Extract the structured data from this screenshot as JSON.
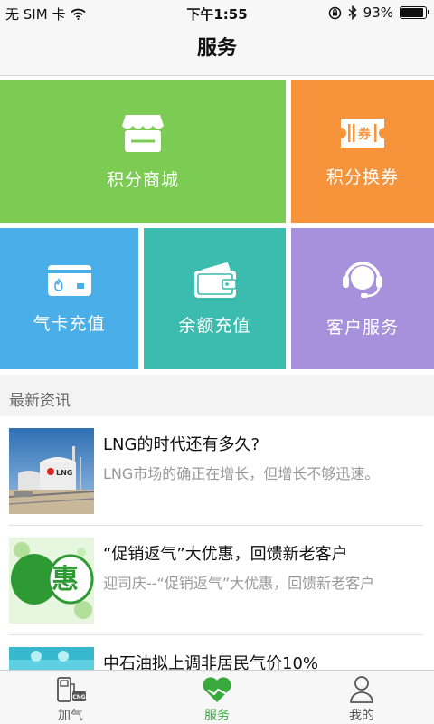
{
  "status_bar": {
    "carrier": "无 SIM 卡",
    "time": "下午1:55",
    "battery_percent": "93%",
    "battery_level": 0.93
  },
  "nav": {
    "title": "服务"
  },
  "tiles": {
    "mall": {
      "label": "积分商城",
      "icon": "store-icon",
      "color": "#7ccc54"
    },
    "coupon": {
      "label": "积分换券",
      "icon": "coupon-icon",
      "coupon_text": "券",
      "color": "#f7943b"
    },
    "gas_card": {
      "label": "气卡充值",
      "icon": "gas-card-icon",
      "color": "#4aaee8"
    },
    "balance": {
      "label": "余额充值",
      "icon": "wallet-icon",
      "color": "#3cbcae"
    },
    "customer_service": {
      "label": "客户服务",
      "icon": "headset-icon",
      "color": "#a891dc"
    }
  },
  "news": {
    "header": "最新资讯",
    "items": [
      {
        "title": "LNG的时代还有多久?",
        "desc": "LNG市场的确正在增长，但增长不够迅速。",
        "thumb": "lng-tank-photo",
        "thumb_text": "LNG"
      },
      {
        "title": "“促销返气”大优惠，回馈新老客户",
        "desc": "迎司庆--“促销返气”大优惠，回馈新老客户",
        "thumb": "promotion-image",
        "thumb_text": "优惠"
      },
      {
        "title": "中石油拟上调非居民气价10%",
        "desc": "",
        "thumb": "news-image"
      }
    ]
  },
  "tab_bar": {
    "items": [
      {
        "label": "加气",
        "icon": "gas-pump-icon",
        "badge_text": "CNG"
      },
      {
        "label": "服务",
        "icon": "heart-hands-icon",
        "active": true
      },
      {
        "label": "我的",
        "icon": "user-icon"
      }
    ],
    "active_color": "#39a93d"
  }
}
